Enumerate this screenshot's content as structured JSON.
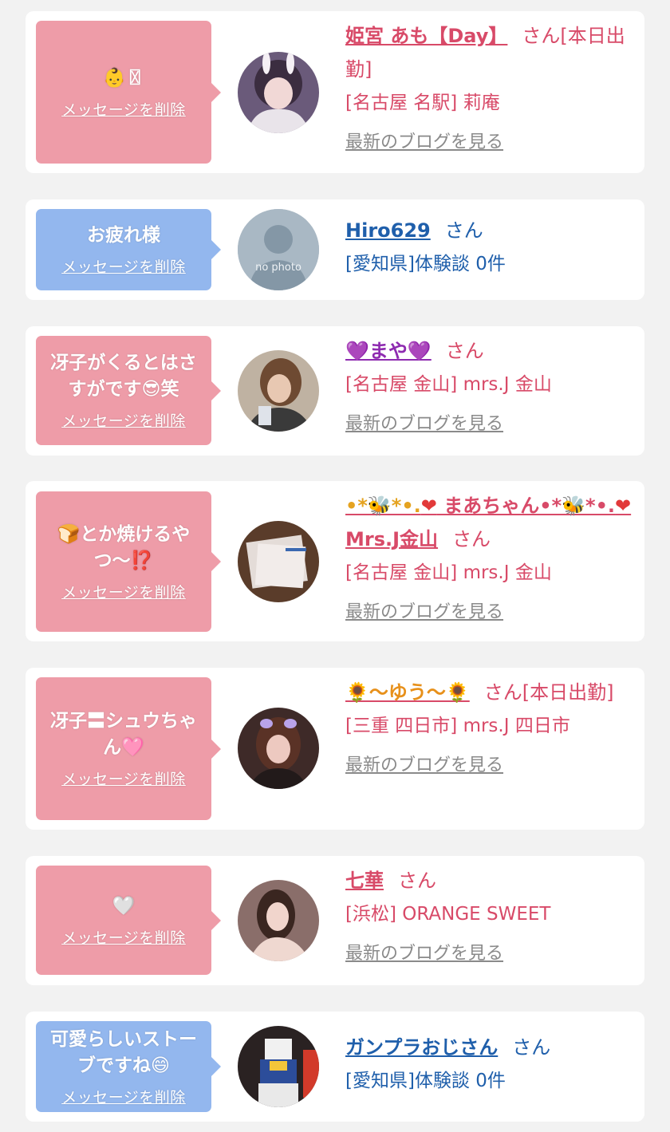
{
  "delete_label": "メッセージを削除",
  "blog_label": "最新のブログを見る",
  "san_label": "さん",
  "colors": {
    "pink_bubble": "#ee9ca8",
    "blue_bubble": "#93b7ee",
    "pink_text": "#d84a68",
    "blue_text": "#1f5fab",
    "blog_gray": "#8a8a8a"
  },
  "messages": [
    {
      "bubble_color": "pink",
      "bubble_text": "👶〿",
      "name": "姫宮 あも【Day】",
      "suffix": "[本日出勤]",
      "shop": "[名古屋 名駅] 莉庵",
      "has_blog": true
    },
    {
      "bubble_color": "blue",
      "bubble_text": "お疲れ様",
      "name": "Hiro629",
      "suffix": "",
      "shop": "[愛知県]体験談 0件",
      "has_blog": false,
      "avatar_label": "no photo"
    },
    {
      "bubble_color": "pink",
      "bubble_text": "冴子がくるとはさすがです😎笑",
      "name": "💜まや💜",
      "suffix": "",
      "shop": "[名古屋 金山] mrs.J 金山",
      "has_blog": true
    },
    {
      "bubble_color": "pink",
      "bubble_text": "🍞とか焼けるやつ〜⁉️",
      "name_parts": [
        "•*🐝*•.",
        "❤",
        " まあちゃん•*🐝*•.",
        "❤",
        "Mrs.J金山"
      ],
      "suffix": "",
      "shop": "[名古屋 金山] mrs.J 金山",
      "has_blog": true
    },
    {
      "bubble_color": "pink",
      "bubble_text": "冴子〓シュウちゃん🩷",
      "name": "🌻〜ゆう〜🌻",
      "suffix": "[本日出勤]",
      "shop": "[三重 四日市] mrs.J 四日市",
      "has_blog": true
    },
    {
      "bubble_color": "pink",
      "bubble_text": "🤍",
      "name": "七華",
      "suffix": "",
      "shop": "[浜松] ORANGE SWEET",
      "has_blog": true
    },
    {
      "bubble_color": "blue",
      "bubble_text": "可愛らしいストーブですね😄",
      "name": "ガンプラおじさん",
      "suffix": "",
      "shop": "[愛知県]体験談 0件",
      "has_blog": false
    }
  ]
}
